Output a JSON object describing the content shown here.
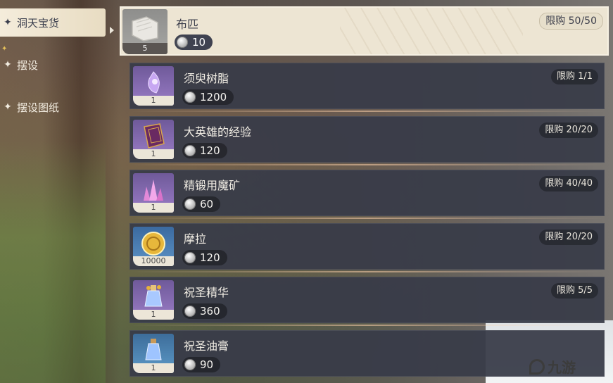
{
  "sidebar": {
    "tabs": [
      {
        "label": "洞天宝货",
        "active": true
      },
      {
        "label": "摆设",
        "active": false
      },
      {
        "label": "摆设图纸",
        "active": false
      }
    ]
  },
  "shop": {
    "items": [
      {
        "name": "布匹",
        "price": "10",
        "qty": "5",
        "limit": "限购 50/50",
        "icon": "cloth-bolt-icon",
        "selected": true
      },
      {
        "name": "须臾树脂",
        "price": "1200",
        "qty": "1",
        "limit": "限购 1/1",
        "icon": "transient-resin-icon"
      },
      {
        "name": "大英雄的经验",
        "price": "120",
        "qty": "1",
        "limit": "限购 20/20",
        "icon": "heros-wit-book-icon"
      },
      {
        "name": "精锻用魔矿",
        "price": "60",
        "qty": "1",
        "limit": "限购 40/40",
        "icon": "mystic-ore-crystal-icon"
      },
      {
        "name": "摩拉",
        "price": "120",
        "qty": "10000",
        "limit": "限购 20/20",
        "icon": "mora-coin-icon"
      },
      {
        "name": "祝圣精华",
        "price": "360",
        "qty": "1",
        "limit": "限购 5/5",
        "icon": "sanctifying-essence-icon"
      },
      {
        "name": "祝圣油膏",
        "price": "90",
        "qty": "1",
        "limit": "",
        "icon": "sanctifying-unction-icon"
      }
    ]
  },
  "watermark": {
    "text": "九游"
  },
  "colors": {
    "panel": "#383c48",
    "selected": "#ede5d3",
    "accent_gold": "#e6c15a"
  }
}
